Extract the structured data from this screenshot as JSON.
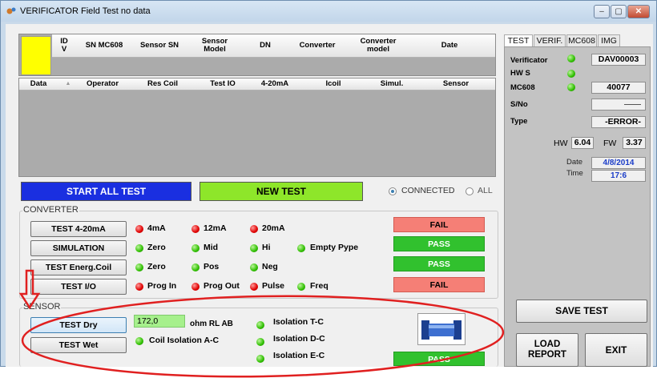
{
  "window": {
    "title": "VERIFICATOR Field Test no data",
    "minimize": "–",
    "maximize": "▢",
    "close": "✕"
  },
  "top_table": {
    "columns": [
      "ID\nV",
      "SN MC608",
      "Sensor SN",
      "Sensor\nModel",
      "DN",
      "Converter",
      "Converter\nmodel",
      "Date"
    ]
  },
  "log_table": {
    "columns": [
      "Data",
      "▲",
      "Operator",
      "Res Coil",
      "Test IO",
      "4-20mA",
      "Icoil",
      "Simul.",
      "Sensor"
    ]
  },
  "buttons": {
    "start_all": "START ALL TEST",
    "new_test": "NEW TEST",
    "save_test": "SAVE TEST",
    "load_report": "LOAD\nREPORT",
    "exit": "EXIT"
  },
  "mode": {
    "connected": "CONNECTED",
    "all": "ALL",
    "selected": "connected"
  },
  "converter": {
    "label": "CONVERTER",
    "rows": [
      {
        "button": "TEST 4-20mA",
        "leds": [
          {
            "label": "4mA",
            "color": "red"
          },
          {
            "label": "12mA",
            "color": "red"
          },
          {
            "label": "20mA",
            "color": "red"
          }
        ],
        "result": "FAIL"
      },
      {
        "button": "SIMULATION",
        "leds": [
          {
            "label": "Zero",
            "color": "green"
          },
          {
            "label": "Mid",
            "color": "green"
          },
          {
            "label": "Hi",
            "color": "green"
          },
          {
            "label": "Empty Pype",
            "color": "green"
          }
        ],
        "result": "PASS"
      },
      {
        "button": "TEST Energ.Coil",
        "leds": [
          {
            "label": "Zero",
            "color": "green"
          },
          {
            "label": "Pos",
            "color": "green"
          },
          {
            "label": "Neg",
            "color": "green"
          }
        ],
        "result": "PASS"
      },
      {
        "button": "TEST I/O",
        "leds": [
          {
            "label": "Prog In",
            "color": "red"
          },
          {
            "label": "Prog Out",
            "color": "red"
          },
          {
            "label": "Pulse",
            "color": "red"
          },
          {
            "label": "Freq",
            "color": "green"
          }
        ],
        "result": "FAIL"
      }
    ]
  },
  "sensor": {
    "label": "SENSOR",
    "test_dry": "TEST Dry",
    "test_wet": "TEST Wet",
    "resistance_value": "172,0",
    "resistance_unit": "ohm RL AB",
    "coil_isolation": "Coil Isolation A-C",
    "isolation_tc": "Isolation T-C",
    "isolation_dc": "Isolation D-C",
    "isolation_ec": "Isolation E-C",
    "result": "PASS"
  },
  "tabs": [
    "TEST",
    "VERIF.",
    "MC608",
    "IMG"
  ],
  "info": {
    "verificator_label": "Verificator",
    "verificator_value": "DAV00003",
    "hws_label": "HW S",
    "mc608_label": "MC608",
    "mc608_value": "40077",
    "sno_label": "S/No",
    "sno_value": "——",
    "type_label": "Type",
    "type_value": "-ERROR-",
    "hw_label": "HW",
    "hw_value": "6.04",
    "fw_label": "FW",
    "fw_value": "3.37",
    "date_label": "Date",
    "date_value": "4/8/2014",
    "time_label": "Time",
    "time_value": "17:6"
  },
  "colors": {
    "fail": "#f57f76",
    "pass": "#31c12e",
    "start_all": "#1a2fe0",
    "new_test": "#8ee62a",
    "selected_cell": "#ffff00",
    "annotation": "#e02020"
  }
}
